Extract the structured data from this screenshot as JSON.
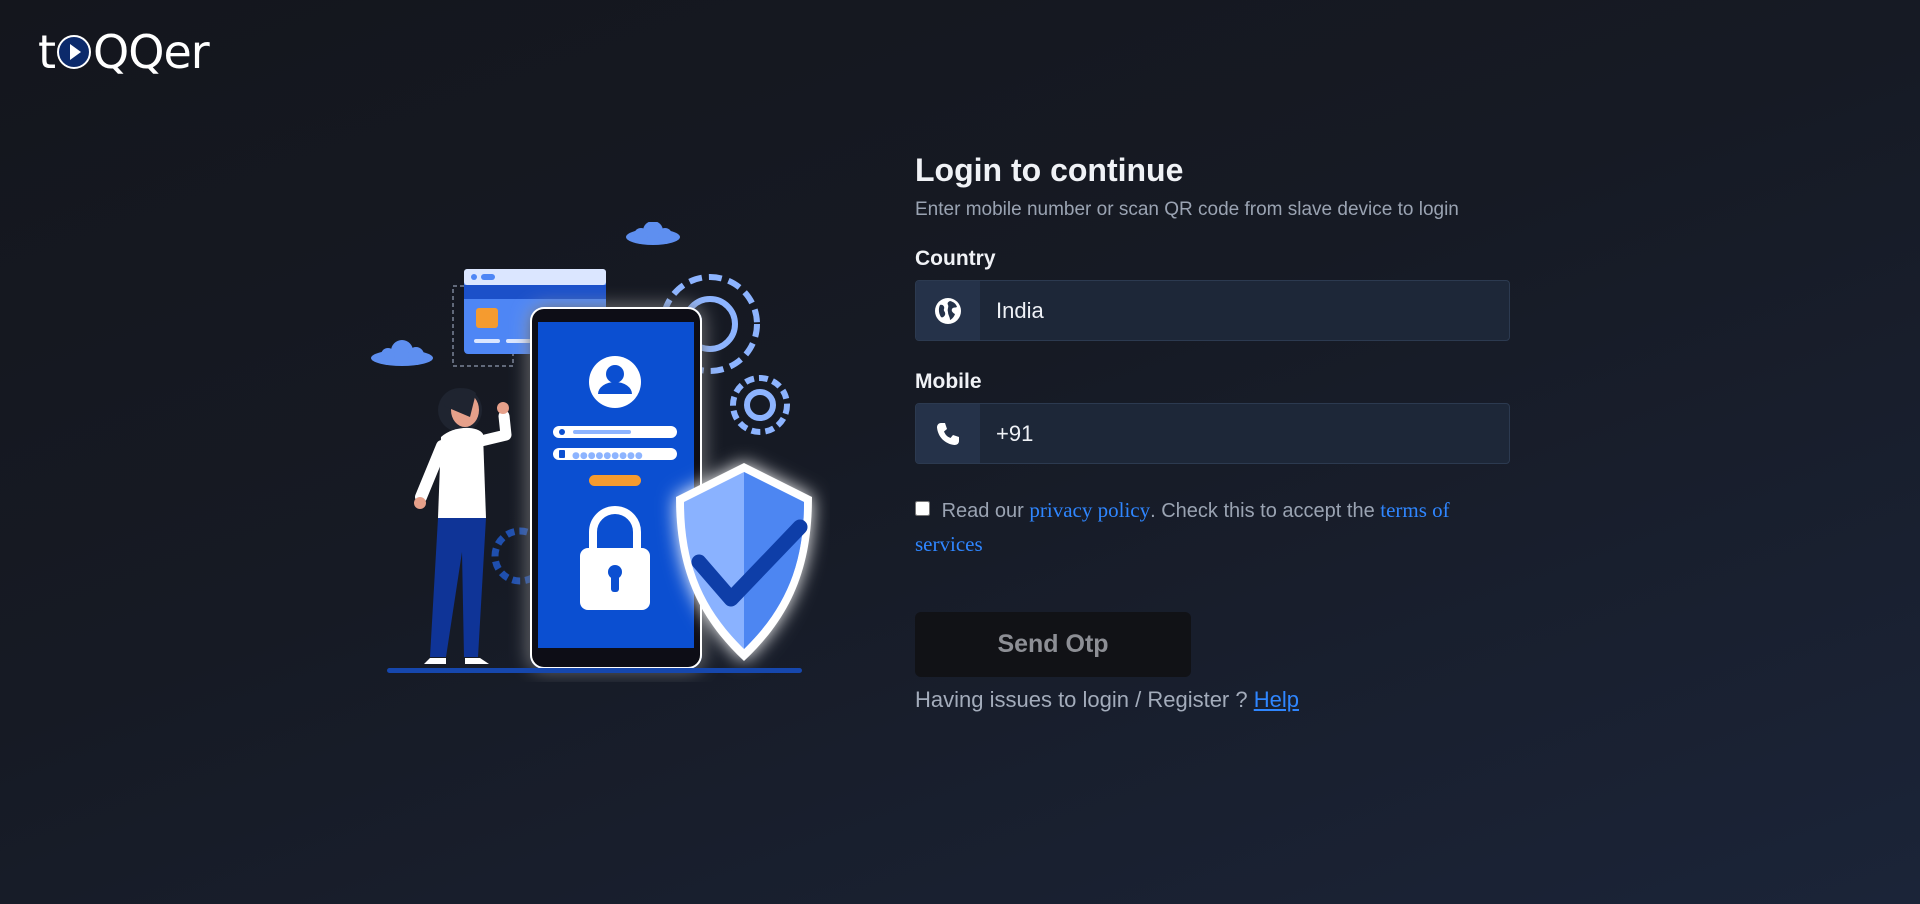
{
  "brand": {
    "logo_text_pre": "t",
    "logo_text_post": "QQer"
  },
  "login": {
    "title": "Login to continue",
    "subtitle": "Enter mobile number or scan QR code from slave device to login"
  },
  "country": {
    "label": "Country",
    "value": "India",
    "icon": "globe-icon"
  },
  "mobile": {
    "label": "Mobile",
    "value": "+91",
    "icon": "phone-icon"
  },
  "consent": {
    "text_1": "Read our ",
    "privacy_link": "privacy policy",
    "text_2": ". Check this to accept the ",
    "terms_link": "terms of services",
    "checked": false
  },
  "send_button": {
    "label": "Send Otp"
  },
  "help": {
    "text": "Having issues to login / Register ? ",
    "link": "Help"
  },
  "colors": {
    "accent": "#2f86ff",
    "background": "#161a24",
    "field_bg": "#1d2738",
    "illustration_blue": "#0b4fd1"
  }
}
